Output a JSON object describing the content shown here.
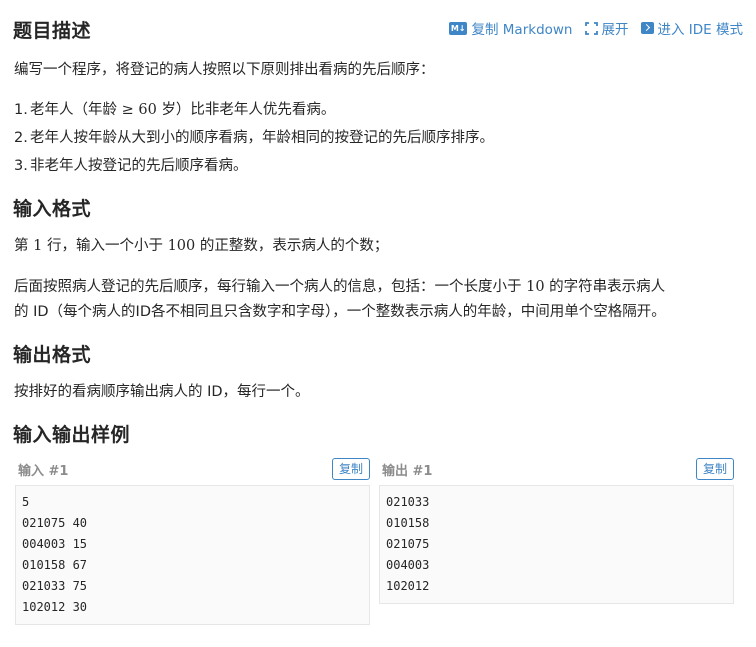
{
  "header": {
    "title": "题目描述",
    "copy_markdown": "复制 Markdown",
    "md_badge": "M↓",
    "expand": "展开",
    "ide_mode": "进入 IDE 模式"
  },
  "description": {
    "intro": "编写一个程序，将登记的病人按照以下原则排出看病的先后顺序：",
    "rules": [
      {
        "idx": "1.",
        "text_a": "老年人（年龄",
        "math": " ≥ 60 ",
        "text_b": "岁）比非老年人优先看病。"
      },
      {
        "idx": "2.",
        "text": "老年人按年龄从大到小的顺序看病，年龄相同的按登记的先后顺序排序。"
      },
      {
        "idx": "3.",
        "text": "非老年人按登记的先后顺序看病。"
      }
    ]
  },
  "input_format": {
    "title": "输入格式",
    "line1_a": "第 ",
    "line1_n1": "1",
    "line1_b": " 行，输入一个小于 ",
    "line1_n2": "100",
    "line1_c": " 的正整数，表示病人的个数；",
    "line2_a": "后面按照病人登记的先后顺序，每行输入一个病人的信息，包括：一个长度小于 ",
    "line2_n": "10",
    "line2_b": " 的字符串表示病人",
    "line3": "的 ID（每个病人的ID各不相同且只含数字和字母），一个整数表示病人的年龄，中间用单个空格隔开。"
  },
  "output_format": {
    "title": "输出格式",
    "text": "按排好的看病顺序输出病人的 ID，每行一个。"
  },
  "samples": {
    "title": "输入输出样例",
    "input": {
      "label": "输入 #1",
      "copy": "复制",
      "lines": [
        "5",
        "021075 40",
        "004003 15",
        "010158 67",
        "021033 75",
        "102012 30"
      ]
    },
    "output": {
      "label": "输出 #1",
      "copy": "复制",
      "lines": [
        "021033",
        "010158",
        "021075",
        "004003",
        "102012"
      ]
    }
  }
}
